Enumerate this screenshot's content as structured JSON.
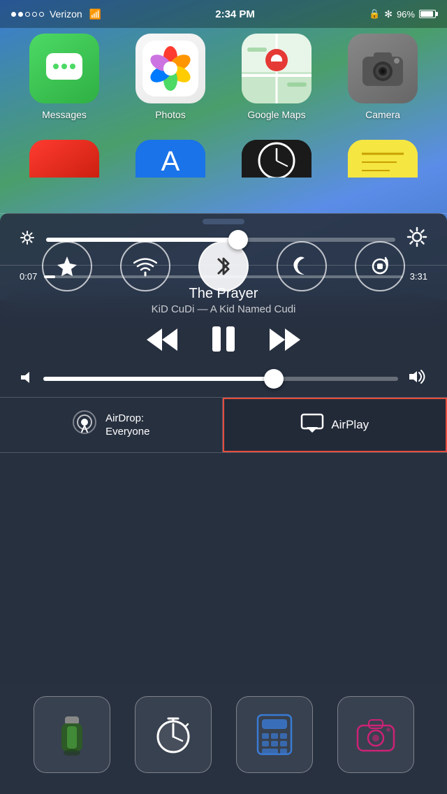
{
  "statusBar": {
    "carrier": "Verizon",
    "time": "2:34 PM",
    "battery": "96%",
    "bluetoothVisible": true,
    "lockVisible": true
  },
  "homescreen": {
    "apps": [
      {
        "id": "messages",
        "label": "Messages"
      },
      {
        "id": "photos",
        "label": "Photos"
      },
      {
        "id": "maps",
        "label": "Google Maps"
      },
      {
        "id": "camera",
        "label": "Camera"
      }
    ]
  },
  "controlCenter": {
    "pullHandle": "pull-handle",
    "toggles": [
      {
        "id": "airplane",
        "label": "Airplane Mode",
        "active": false,
        "icon": "✈"
      },
      {
        "id": "wifi",
        "label": "Wi-Fi",
        "active": false,
        "icon": "wifi"
      },
      {
        "id": "bluetooth",
        "label": "Bluetooth",
        "active": true,
        "icon": "bluetooth"
      },
      {
        "id": "donotdisturb",
        "label": "Do Not Disturb",
        "active": false,
        "icon": "moon"
      },
      {
        "id": "rotation",
        "label": "Rotation Lock",
        "active": false,
        "icon": "rotation"
      }
    ],
    "brightness": {
      "value": 55,
      "percent": 55
    },
    "music": {
      "currentTime": "0:07",
      "totalTime": "3:31",
      "progressPercent": 3,
      "title": "The Prayer",
      "artist": "KiD CuDi",
      "album": "A Kid Named Cudi",
      "artistAlbum": "KiD CuDi — A Kid Named Cudi"
    },
    "volume": {
      "value": 65,
      "percent": 65
    },
    "airdrop": {
      "label": "AirDrop:",
      "status": "Everyone"
    },
    "airplay": {
      "label": "AirPlay",
      "highlighted": true
    },
    "quickAccess": [
      {
        "id": "flashlight",
        "label": "Flashlight"
      },
      {
        "id": "timer",
        "label": "Timer"
      },
      {
        "id": "calculator",
        "label": "Calculator"
      },
      {
        "id": "camera2",
        "label": "Camera"
      }
    ]
  }
}
